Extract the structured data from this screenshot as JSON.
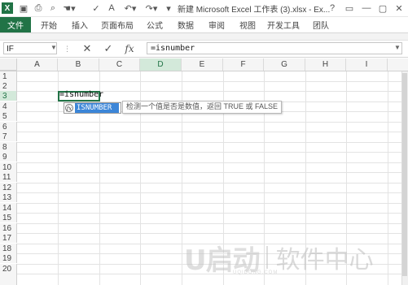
{
  "window": {
    "title": "新建 Microsoft Excel 工作表 (3).xlsx - Ex...",
    "controls": [
      "?",
      "▭",
      "—",
      "▢",
      "✕"
    ]
  },
  "quick_access": {
    "icons": [
      "excel-logo-icon",
      "save-icon",
      "print-icon",
      "print-preview-icon",
      "touch-mode-icon",
      "spelling-icon",
      "undo-icon",
      "redo-icon",
      "font-size-icon",
      "customize-icon"
    ]
  },
  "ribbon_tabs": [
    "文件",
    "开始",
    "插入",
    "页面布局",
    "公式",
    "数据",
    "审阅",
    "视图",
    "开发工具",
    "团队"
  ],
  "accent_color": "#217346",
  "formula_bar": {
    "name_box": "IF",
    "formula": "=isnumber",
    "fx_label": "fx"
  },
  "columns": [
    "A",
    "B",
    "C",
    "D",
    "E",
    "F",
    "G",
    "H",
    "I"
  ],
  "rows": [
    "1",
    "2",
    "3",
    "4",
    "5",
    "6",
    "7",
    "8",
    "9",
    "10",
    "11",
    "12",
    "13",
    "14",
    "15",
    "16",
    "17",
    "18",
    "19",
    "20"
  ],
  "active_cell": {
    "ref": "B3",
    "entry": "=isnumber"
  },
  "autocomplete": {
    "items": [
      "ISNUMBER"
    ],
    "tooltip": "检测一个值是否是数值，返回 TRUE 或 FALSE"
  },
  "watermark": {
    "logo": "U启动",
    "text": "软件中心",
    "sub": "UQIDONG.COM"
  }
}
